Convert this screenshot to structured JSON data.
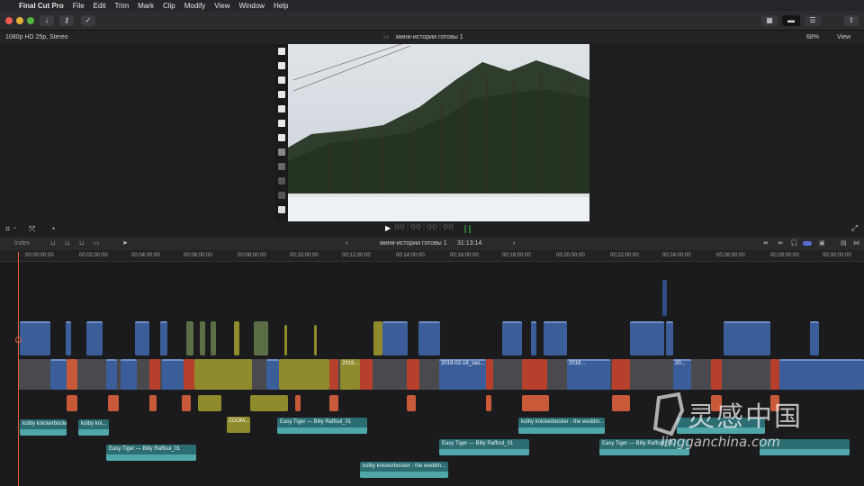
{
  "menubar": {
    "app_name": "Final Cut Pro",
    "items": [
      "File",
      "Edit",
      "Trim",
      "Mark",
      "Clip",
      "Modify",
      "View",
      "Window",
      "Help"
    ]
  },
  "viewer": {
    "format": "1080p HD 25p, Stereo",
    "project_title": "мини-истории готовы 1",
    "zoom": "68%",
    "view_menu": "View"
  },
  "transport": {
    "timecode": "00:00:00:00"
  },
  "timeline": {
    "index_label": "Index",
    "project_title": "мини-истории готовы 1",
    "duration": "31:13:14",
    "ruler_ticks": [
      "00:00:00:00",
      "00:02:00:00",
      "00:04:00:00",
      "00:06:00:00",
      "00:08:00:00",
      "00:10:00:00",
      "00:12:00:00",
      "00:14:00:00",
      "00:16:00:00",
      "00:18:00:00",
      "00:20:00:00",
      "00:22:00:00",
      "00:24:00:00",
      "00:26:00:00",
      "00:28:00:00",
      "00:30:00:00"
    ],
    "clip_labels": {
      "c1": "2019...",
      "c2": "2019-02-16_sas...",
      "c3": "2019...",
      "c4": "20...",
      "zoom": "ZOOM..."
    },
    "audio_clips": {
      "a1": "kolby knickerbocker ...",
      "a2": "kolby kni...",
      "a3": "Easy Tiger — Billy Raffoul_01",
      "a4": "Easy Tiger — Billy Raffoul_01",
      "a5": "kolby knickerbocker - the weddin...",
      "a6": "Easy Tiger — Billy Raffoul_01",
      "a7": "kolby knickerbocker - the weddin...",
      "a8": "Easy Tiger — Billy Raffoul_01"
    }
  },
  "watermark": {
    "cn": "灵感中国",
    "url": "lingganchina.com"
  },
  "colors": {
    "accent": "#e0623a",
    "video_clip": "#3b5e9a",
    "audio_clip": "#2c6d72"
  }
}
